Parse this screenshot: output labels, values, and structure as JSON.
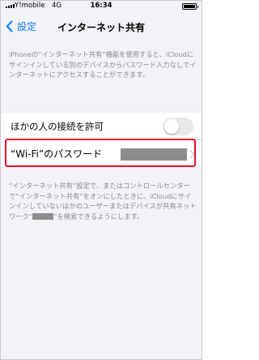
{
  "status_bar": {
    "carrier": "Y!mobile",
    "network": "4G",
    "time": "16:34",
    "battery_level": 1.0
  },
  "nav": {
    "back_label": "設定",
    "title": "インターネット共有"
  },
  "header_note": "iPhoneの“インターネット共有”機能を使用すると、iCloudにサインインしている別のデバイスからパスワード入力なしでインターネットにアクセスすることができます。",
  "settings": {
    "allow_others_label": "ほかの人の接続を許可",
    "allow_others_enabled": false,
    "wifi_password_label": "“Wi-Fi”のパスワード"
  },
  "footer_note": {
    "before_redaction": "“インターネット共有”設定で、またはコントロールセンターで“インターネット共有”をオンにしたときに、iCloudにサインインしていないほかのユーザーまたはデバイスが共有ネットワーク“",
    "after_redaction": "”を検索できるようにします。"
  },
  "colors": {
    "accent": "#0a7aff",
    "highlight": "#e8102a",
    "background": "#f2f2f7",
    "secondary_text": "#8a8a8e"
  }
}
